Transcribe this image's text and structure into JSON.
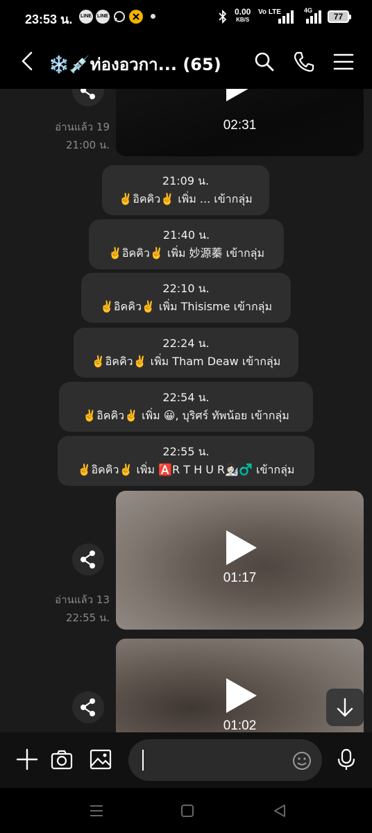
{
  "status_bar": {
    "time": "23:53 น.",
    "notif_icons": [
      "LINE",
      "LINE",
      "chat-bubble",
      "app-badge"
    ],
    "net_speed": "0.00",
    "net_unit": "KB/S",
    "volte": "Vo LTE",
    "network": "4G",
    "battery": "77"
  },
  "header": {
    "title": "❄️💉ท่องอวกา...",
    "count": "(65)"
  },
  "messages": {
    "video1": {
      "duration": "02:31",
      "read": "อ่านแล้ว 19",
      "time": "21:00 น."
    },
    "system": [
      {
        "time": "21:09 น.",
        "text": "✌️อิคคิว✌️ เพิ่ม ... เข้ากลุ่ม"
      },
      {
        "time": "21:40 น.",
        "text": "✌️อิคคิว✌️ เพิ่ม 妙源蓁 เข้ากลุ่ม"
      },
      {
        "time": "22:10 น.",
        "text": "✌️อิคคิว✌️ เพิ่ม Thisisme เข้ากลุ่ม"
      },
      {
        "time": "22:24 น.",
        "text": "✌️อิคคิว✌️ เพิ่ม Tham Deaw เข้ากลุ่ม"
      },
      {
        "time": "22:54 น.",
        "text": "✌️อิคคิว✌️ เพิ่ม 😀, บุริศร์ ทัพน้อย เข้ากลุ่ม"
      },
      {
        "time": "22:55 น.",
        "text": "✌️อิคคิว✌️ เพิ่ม 🅰️R T H U R👩🏻‍🔬♂️ เข้ากลุ่ม"
      }
    ],
    "video2": {
      "duration": "01:17",
      "read": "อ่านแล้ว 13",
      "time": "22:55 น."
    },
    "video3": {
      "duration": "01:02"
    }
  },
  "input": {
    "placeholder": ""
  },
  "colors": {
    "background": "#1b1b1b",
    "system_bubble": "#2e2e2e",
    "read_text": "#8a8a8a",
    "bars": "#000000"
  }
}
